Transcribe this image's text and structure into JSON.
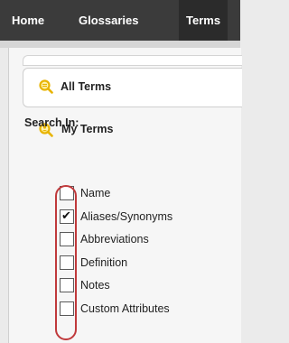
{
  "topnav": {
    "items": [
      {
        "label": "Home"
      },
      {
        "label": "Glossaries"
      },
      {
        "label": "Terms"
      }
    ]
  },
  "sidebar": {
    "all_terms": "All Terms",
    "my_terms": "My Terms",
    "search_in_label": "Search In:",
    "options": [
      {
        "label": "Name",
        "checked": false
      },
      {
        "label": "Aliases/Synonyms",
        "checked": true
      },
      {
        "label": "Abbreviations",
        "checked": false
      },
      {
        "label": "Definition",
        "checked": false
      },
      {
        "label": "Notes",
        "checked": false
      },
      {
        "label": "Custom Attributes",
        "checked": false
      }
    ]
  },
  "colors": {
    "nav_bg": "#3b3b3b",
    "icon_yellow": "#e8b400",
    "highlight_red": "#c0393b"
  },
  "icons": [
    "search-icon"
  ]
}
